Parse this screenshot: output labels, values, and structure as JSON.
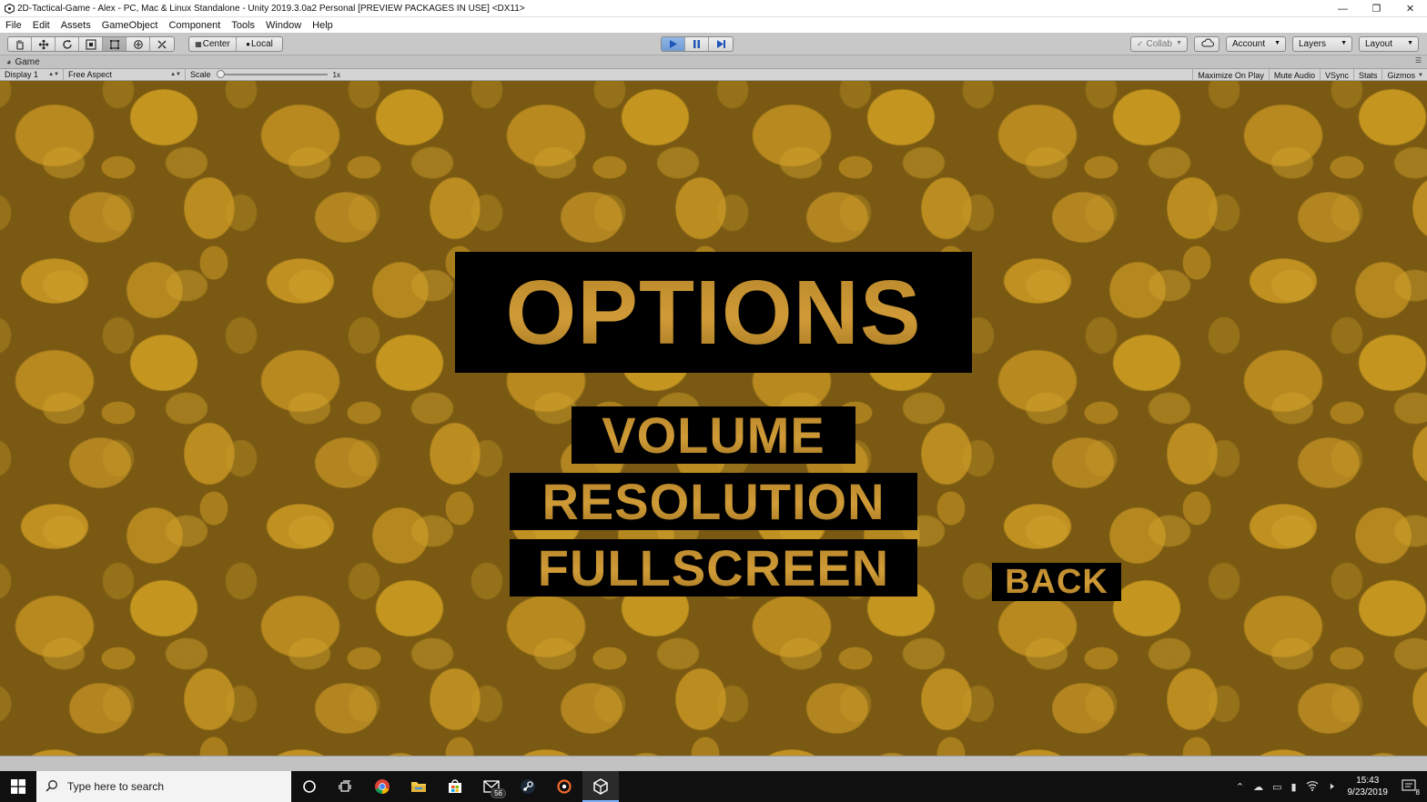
{
  "window": {
    "title": "2D-Tactical-Game - Alex - PC, Mac & Linux Standalone - Unity 2019.3.0a2 Personal [PREVIEW PACKAGES IN USE] <DX11>",
    "controls": [
      "minimize-icon",
      "restore-icon",
      "close-icon"
    ]
  },
  "menu": [
    "File",
    "Edit",
    "Assets",
    "GameObject",
    "Component",
    "Tools",
    "Window",
    "Help"
  ],
  "toolbar": {
    "tools": [
      "hand-icon",
      "move-icon",
      "rotate-icon",
      "scale-icon",
      "rect-icon",
      "transform-icon",
      "custom-tool-icon"
    ],
    "pivot_center": "Center",
    "pivot_local": "Local",
    "play_controls": [
      "play-icon",
      "pause-icon",
      "step-icon"
    ],
    "collab": "Collab",
    "account": "Account",
    "layers": "Layers",
    "layout": "Layout"
  },
  "game_tab": {
    "label": "Game"
  },
  "game_bar": {
    "display": "Display 1",
    "aspect": "Free Aspect",
    "scale_label": "Scale",
    "scale_value": "1x",
    "right_items": [
      "Maximize On Play",
      "Mute Audio",
      "VSync",
      "Stats",
      "Gizmos"
    ]
  },
  "game_menu": {
    "title": "OPTIONS",
    "items": [
      "VOLUME",
      "RESOLUTION",
      "FULLSCREEN"
    ],
    "back": "BACK",
    "text_color": "#c9962e",
    "background_color": "#b8891f"
  },
  "taskbar": {
    "search_placeholder": "Type here to search",
    "mail_badge": "56",
    "time": "15:43",
    "date": "9/23/2019",
    "notification_count": "8",
    "apps": [
      "cortana-icon",
      "task-view-icon",
      "chrome-icon",
      "file-explorer-icon",
      "store-icon",
      "mail-icon",
      "steam-icon",
      "origin-icon",
      "unity-icon"
    ]
  }
}
